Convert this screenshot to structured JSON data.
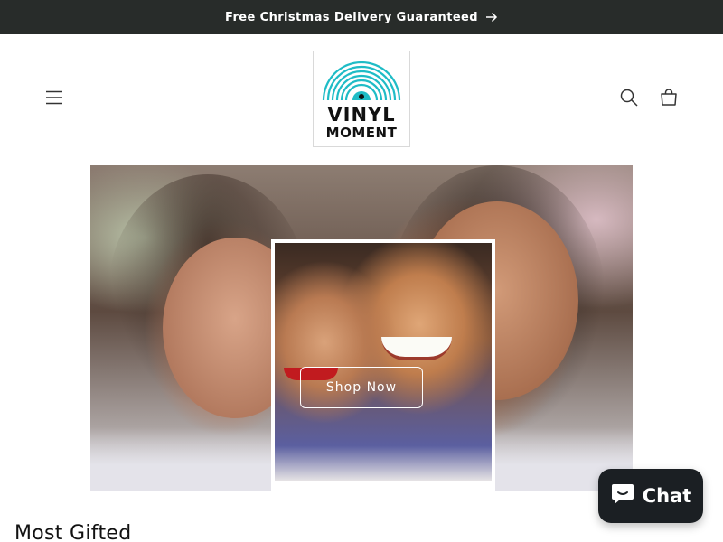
{
  "announcement": {
    "text": "Free Christmas Delivery Guaranteed",
    "icon": "arrow-right-icon"
  },
  "header": {
    "menu_icon": "hamburger-menu-icon",
    "logo": {
      "line1": "VINYL",
      "line2": "MOMENT",
      "accent": "#1fbcc6"
    },
    "search_icon": "search-icon",
    "cart_icon": "cart-icon"
  },
  "hero": {
    "button_label": "Shop Now"
  },
  "section": {
    "title": "Most Gifted"
  },
  "chat_widget": {
    "label": "Chat",
    "icon": "chat-bubble-icon",
    "background": "#1b1f23"
  },
  "colors": {
    "announcement_bg": "#282c2a",
    "brand_accent": "#1fbcc6"
  }
}
